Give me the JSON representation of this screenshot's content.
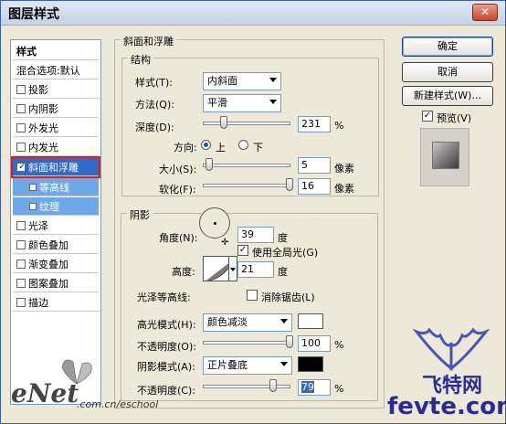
{
  "window": {
    "title": "图层样式",
    "close_label": "✕"
  },
  "left_panel": {
    "items": [
      {
        "label": "样式"
      },
      {
        "label": "混合选项:默认"
      },
      {
        "label": "投影",
        "checked": false
      },
      {
        "label": "内阴影",
        "checked": false
      },
      {
        "label": "外发光",
        "checked": false
      },
      {
        "label": "内发光",
        "checked": false
      },
      {
        "label": "斜面和浮雕",
        "checked": true
      },
      {
        "label": "等高线",
        "checked": false
      },
      {
        "label": "纹理",
        "checked": false
      },
      {
        "label": "光泽",
        "checked": false
      },
      {
        "label": "颜色叠加",
        "checked": false
      },
      {
        "label": "渐变叠加",
        "checked": false
      },
      {
        "label": "图案叠加",
        "checked": false
      },
      {
        "label": "描边",
        "checked": false
      }
    ]
  },
  "bevel": {
    "section_title": "斜面和浮雕",
    "structure": {
      "title": "结构",
      "style_label": "样式(T):",
      "style_value": "内斜面",
      "technique_label": "方法(Q):",
      "technique_value": "平滑",
      "depth_label": "深度(D):",
      "depth_value": "231",
      "depth_unit": "%",
      "direction_label": "方向:",
      "direction_up": "上",
      "direction_down": "下",
      "size_label": "大小(S):",
      "size_value": "5",
      "size_unit": "像素",
      "soften_label": "软化(F):",
      "soften_value": "16",
      "soften_unit": "像素"
    },
    "shading": {
      "title": "阴影",
      "angle_label": "角度(N):",
      "angle_value": "39",
      "angle_unit": "度",
      "global_light_label": "使用全局光(G)",
      "global_light_checked": true,
      "altitude_label": "高度:",
      "altitude_value": "21",
      "altitude_unit": "度",
      "gloss_contour_label": "光泽等高线:",
      "antialias_label": "消除锯齿(L)",
      "antialias_checked": false,
      "highlight_mode_label": "高光模式(H):",
      "highlight_mode_value": "颜色减淡",
      "highlight_color": "#ffffff",
      "highlight_opacity_label": "不透明度(O):",
      "highlight_opacity_value": "100",
      "highlight_opacity_unit": "%",
      "shadow_mode_label": "阴影模式(A):",
      "shadow_mode_value": "正片叠底",
      "shadow_color": "#000000",
      "shadow_opacity_label": "不透明度(C):",
      "shadow_opacity_value": "79",
      "shadow_opacity_unit": "%"
    }
  },
  "buttons": {
    "ok": "确定",
    "cancel": "取消",
    "new_style": "新建样式(W)...",
    "preview_label": "预览(V)",
    "preview_checked": true
  },
  "watermark": {
    "enet_logo": "eNet",
    "enet_url": ".com.cn/eschool",
    "fevte_cn": "飞特网",
    "fevte_url": "fevte.com"
  }
}
